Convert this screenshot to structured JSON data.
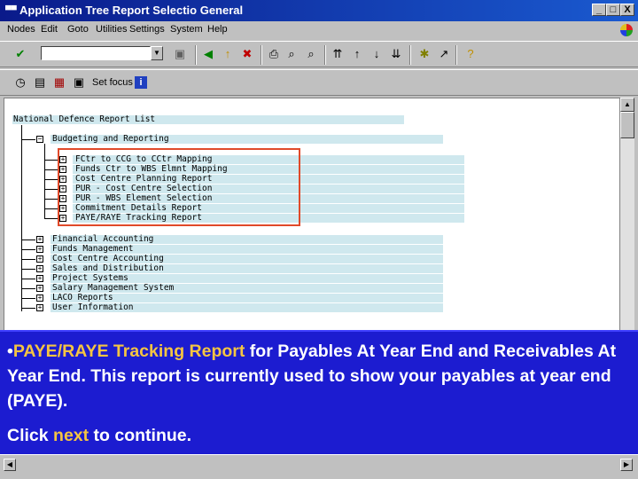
{
  "window": {
    "title": "Application Tree Report Selectio General",
    "controls": [
      "_",
      "□",
      "X"
    ]
  },
  "menu": [
    {
      "label": "Nodes",
      "key": "N"
    },
    {
      "label": "Edit",
      "key": "E"
    },
    {
      "label": "Goto",
      "key": "G"
    },
    {
      "label": "Utilities",
      "key": "U"
    },
    {
      "label": "Settings",
      "key": "S"
    },
    {
      "label": "System",
      "key": "S"
    },
    {
      "label": "Help",
      "key": "H"
    }
  ],
  "toolbar2": {
    "setfocus_label": "Set focus"
  },
  "tree": {
    "root": "National Defence Report List",
    "budgeting": "Budgeting and Reporting",
    "budgeting_children": [
      "FCtr to CCG to CCtr Mapping",
      "Funds Ctr to WBS Elmnt Mapping",
      "Cost Centre Planning Report",
      "PUR - Cost Centre Selection",
      "PUR - WBS Element Selection",
      "Commitment Details Report",
      "PAYE/RAYE Tracking Report"
    ],
    "other_nodes": [
      "Financial Accounting",
      "Funds Management",
      "Cost Centre Accounting",
      "Sales and Distribution",
      "Project Systems",
      "Salary Management System",
      "LACO Reports",
      "User Information"
    ]
  },
  "overlay": {
    "bullet": "•",
    "highlight": "PAYE/RAYE Tracking Report",
    "line1_rest": " for Payables At Year End and Receivables At Year End.  This report is currently used to show your payables at year end (PAYE).",
    "click": "Click ",
    "next": "next",
    "continue": " to continue."
  },
  "colors": {
    "title_bar": "#0a1a8a",
    "overlay_bg": "#1c1cd0",
    "highlight_text": "#f5c542",
    "selection_box": "#e04a2a",
    "node_bar": "#cfe8ee"
  }
}
